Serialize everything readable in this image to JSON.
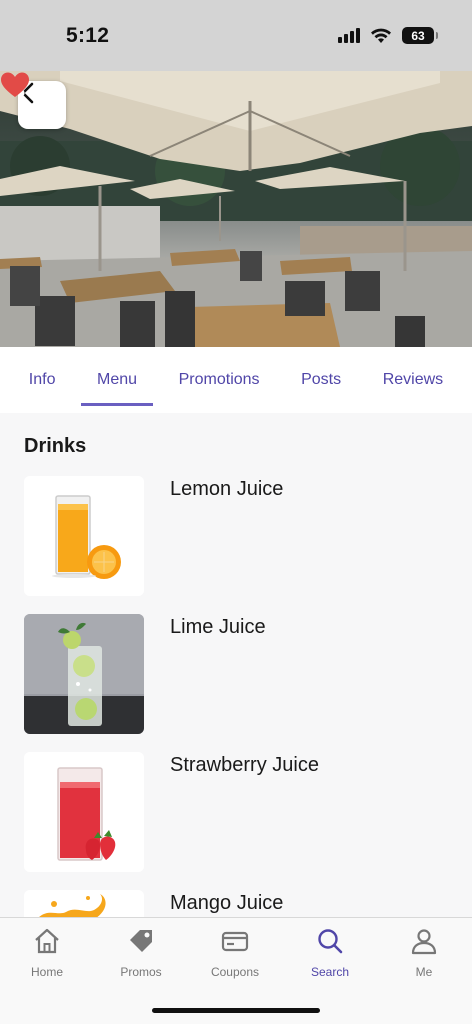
{
  "status_bar": {
    "time": "5:12",
    "battery": "63"
  },
  "tabs": [
    {
      "label": "Info",
      "active": false
    },
    {
      "label": "Menu",
      "active": true
    },
    {
      "label": "Promotions",
      "active": false
    },
    {
      "label": "Posts",
      "active": false
    },
    {
      "label": "Reviews",
      "active": false
    }
  ],
  "menu": {
    "section_title": "Drinks",
    "items": [
      {
        "name": "Lemon Juice",
        "image": "orange-juice-glass"
      },
      {
        "name": "Lime Juice",
        "image": "lime-soda-glass"
      },
      {
        "name": "Strawberry Juice",
        "image": "strawberry-juice-glass"
      },
      {
        "name": "Mango Juice",
        "image": "mango-juice-splash"
      }
    ]
  },
  "bottom_nav": [
    {
      "label": "Home",
      "icon": "home-icon",
      "active": false
    },
    {
      "label": "Promos",
      "icon": "tag-icon",
      "active": false
    },
    {
      "label": "Coupons",
      "icon": "card-icon",
      "active": false
    },
    {
      "label": "Search",
      "icon": "search-icon",
      "active": true
    },
    {
      "label": "Me",
      "icon": "person-icon",
      "active": false
    }
  ],
  "colors": {
    "accent": "#5046a8",
    "heart": "#e24b47",
    "inactive": "#777777"
  }
}
